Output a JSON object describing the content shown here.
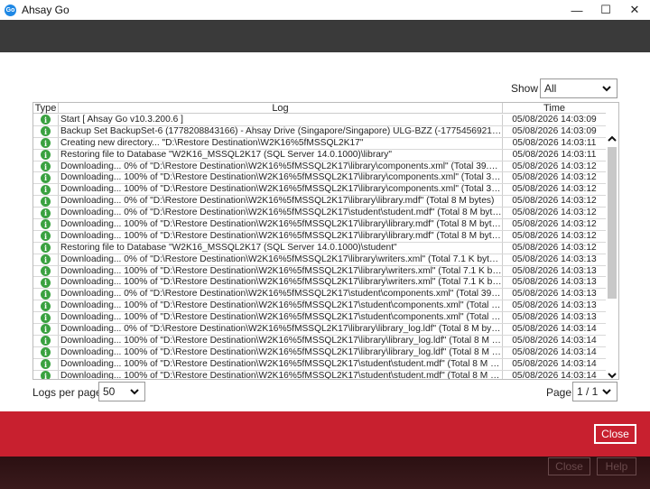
{
  "window": {
    "title": "Ahsay Go",
    "app_icon_text": "Go",
    "minimize": "—",
    "maximize": "☐",
    "close": "✕"
  },
  "filter": {
    "show_label": "Show",
    "show_value": "All"
  },
  "table": {
    "columns": [
      "Type",
      "Log",
      "Time"
    ],
    "rows": [
      {
        "type": "info",
        "log": "Start [ Ahsay Go v10.3.200.6 ]",
        "time": "05/08/2026 14:03:09"
      },
      {
        "type": "info",
        "log": "Backup Set BackupSet-6 (1778208843166) - Ahsay Drive (Singapore/Singapore) ULG-BZZ (-1775456921779) Using Temp...",
        "time": "05/08/2026 14:03:09"
      },
      {
        "type": "info",
        "log": "Creating new directory... \"D:\\Restore Destination\\W2K16%5fMSSQL2K17\"",
        "time": "05/08/2026 14:03:11"
      },
      {
        "type": "info",
        "log": "Restoring file to Database \"W2K16_MSSQL2K17 (SQL Server 14.0.1000)\\library\"",
        "time": "05/08/2026 14:03:11"
      },
      {
        "type": "info",
        "log": "Downloading... 0% of \"D:\\Restore Destination\\W2K16%5fMSSQL2K17\\library\\components.xml\" (Total 39.01 K bytes)",
        "time": "05/08/2026 14:03:12"
      },
      {
        "type": "info",
        "log": "Downloading... 100% of \"D:\\Restore Destination\\W2K16%5fMSSQL2K17\\library\\components.xml\" (Total 39.01 K bytes, Do...",
        "time": "05/08/2026 14:03:12"
      },
      {
        "type": "info",
        "log": "Downloading... 100% of \"D:\\Restore Destination\\W2K16%5fMSSQL2K17\\library\\components.xml\" (Total 39.01 K bytes, Do...",
        "time": "05/08/2026 14:03:12"
      },
      {
        "type": "info",
        "log": "Downloading... 0% of \"D:\\Restore Destination\\W2K16%5fMSSQL2K17\\library\\library.mdf\" (Total 8 M bytes)",
        "time": "05/08/2026 14:03:12"
      },
      {
        "type": "info",
        "log": "Downloading... 0% of \"D:\\Restore Destination\\W2K16%5fMSSQL2K17\\student\\student.mdf\" (Total 8 M bytes)",
        "time": "05/08/2026 14:03:12"
      },
      {
        "type": "info",
        "log": "Downloading... 100% of \"D:\\Restore Destination\\W2K16%5fMSSQL2K17\\library\\library.mdf\" (Total 8 M bytes, Downloaded...",
        "time": "05/08/2026 14:03:12"
      },
      {
        "type": "info",
        "log": "Downloading... 100% of \"D:\\Restore Destination\\W2K16%5fMSSQL2K17\\library\\library.mdf\" (Total 8 M bytes, Downloaded...",
        "time": "05/08/2026 14:03:12"
      },
      {
        "type": "info",
        "log": "Restoring file to Database \"W2K16_MSSQL2K17 (SQL Server 14.0.1000)\\student\"",
        "time": "05/08/2026 14:03:12"
      },
      {
        "type": "info",
        "log": "Downloading... 0% of \"D:\\Restore Destination\\W2K16%5fMSSQL2K17\\library\\writers.xml\" (Total 7.1 K bytes)",
        "time": "05/08/2026 14:03:13"
      },
      {
        "type": "info",
        "log": "Downloading... 100% of \"D:\\Restore Destination\\W2K16%5fMSSQL2K17\\library\\writers.xml\" (Total 7.1 K bytes, Downloade...",
        "time": "05/08/2026 14:03:13"
      },
      {
        "type": "info",
        "log": "Downloading... 100% of \"D:\\Restore Destination\\W2K16%5fMSSQL2K17\\library\\writers.xml\" (Total 7.1 K bytes, Downloade...",
        "time": "05/08/2026 14:03:13"
      },
      {
        "type": "info",
        "log": "Downloading... 0% of \"D:\\Restore Destination\\W2K16%5fMSSQL2K17\\student\\components.xml\" (Total 39.01 K bytes)",
        "time": "05/08/2026 14:03:13"
      },
      {
        "type": "info",
        "log": "Downloading... 100% of \"D:\\Restore Destination\\W2K16%5fMSSQL2K17\\student\\components.xml\" (Total 39.01 K bytes, D...",
        "time": "05/08/2026 14:03:13"
      },
      {
        "type": "info",
        "log": "Downloading... 100% of \"D:\\Restore Destination\\W2K16%5fMSSQL2K17\\student\\components.xml\" (Total 39.01 K bytes, D...",
        "time": "05/08/2026 14:03:13"
      },
      {
        "type": "info",
        "log": "Downloading... 0% of \"D:\\Restore Destination\\W2K16%5fMSSQL2K17\\library\\library_log.ldf\" (Total 8 M bytes)",
        "time": "05/08/2026 14:03:14"
      },
      {
        "type": "info",
        "log": "Downloading... 100% of \"D:\\Restore Destination\\W2K16%5fMSSQL2K17\\library\\library_log.ldf\" (Total 8 M bytes, Download...",
        "time": "05/08/2026 14:03:14"
      },
      {
        "type": "info",
        "log": "Downloading... 100% of \"D:\\Restore Destination\\W2K16%5fMSSQL2K17\\library\\library_log.ldf\" (Total 8 M bytes, Download...",
        "time": "05/08/2026 14:03:14"
      },
      {
        "type": "info",
        "log": "Downloading... 100% of \"D:\\Restore Destination\\W2K16%5fMSSQL2K17\\student\\student.mdf\" (Total 8 M bytes, Download...",
        "time": "05/08/2026 14:03:14"
      },
      {
        "type": "info",
        "log": "Downloading... 100% of \"D:\\Restore Destination\\W2K16%5fMSSQL2K17\\student\\student.mdf\" (Total 8 M bytes, Download...",
        "time": "05/08/2026 14:03:14"
      }
    ]
  },
  "pagination": {
    "logs_per_page_label": "Logs per page",
    "logs_per_page_value": "50",
    "page_label": "Page",
    "page_value": "1 / 1"
  },
  "footer": {
    "close_label": "Close",
    "ghost_close_label": "Close",
    "ghost_help_label": "Help"
  },
  "colors": {
    "accent_red": "#c8202f",
    "info_green": "#3aa140",
    "header_dark": "#3a3a3a"
  }
}
